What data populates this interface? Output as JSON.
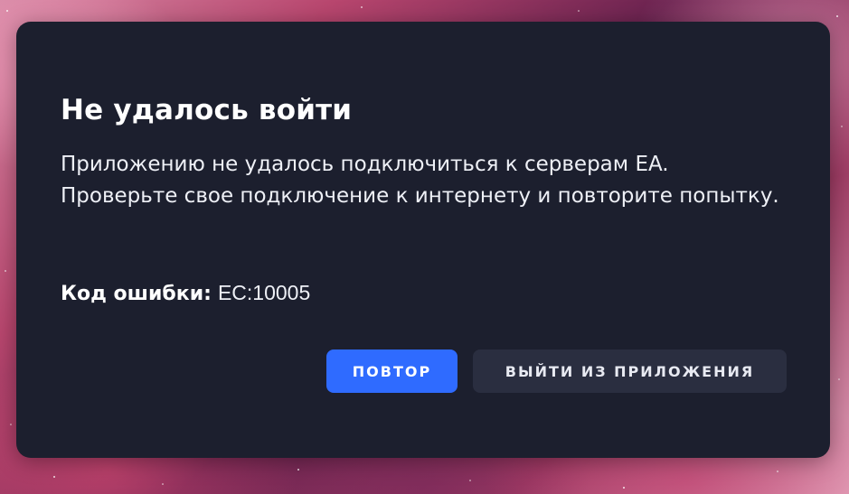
{
  "dialog": {
    "title": "Не удалось войти",
    "message": "Приложению не удалось подключиться к серверам EA. Проверьте свое подключение к интернету и повторите попытку.",
    "error_label": "Код ошибки:",
    "error_code": "EC:10005",
    "buttons": {
      "retry_label": "ПОВТОР",
      "exit_label": "ВЫЙТИ ИЗ ПРИЛОЖЕНИЯ"
    }
  },
  "colors": {
    "dialog_background": "#1c1f2e",
    "primary_button": "#2f6bff",
    "secondary_button": "#2a2e40",
    "text": "#ffffff"
  }
}
